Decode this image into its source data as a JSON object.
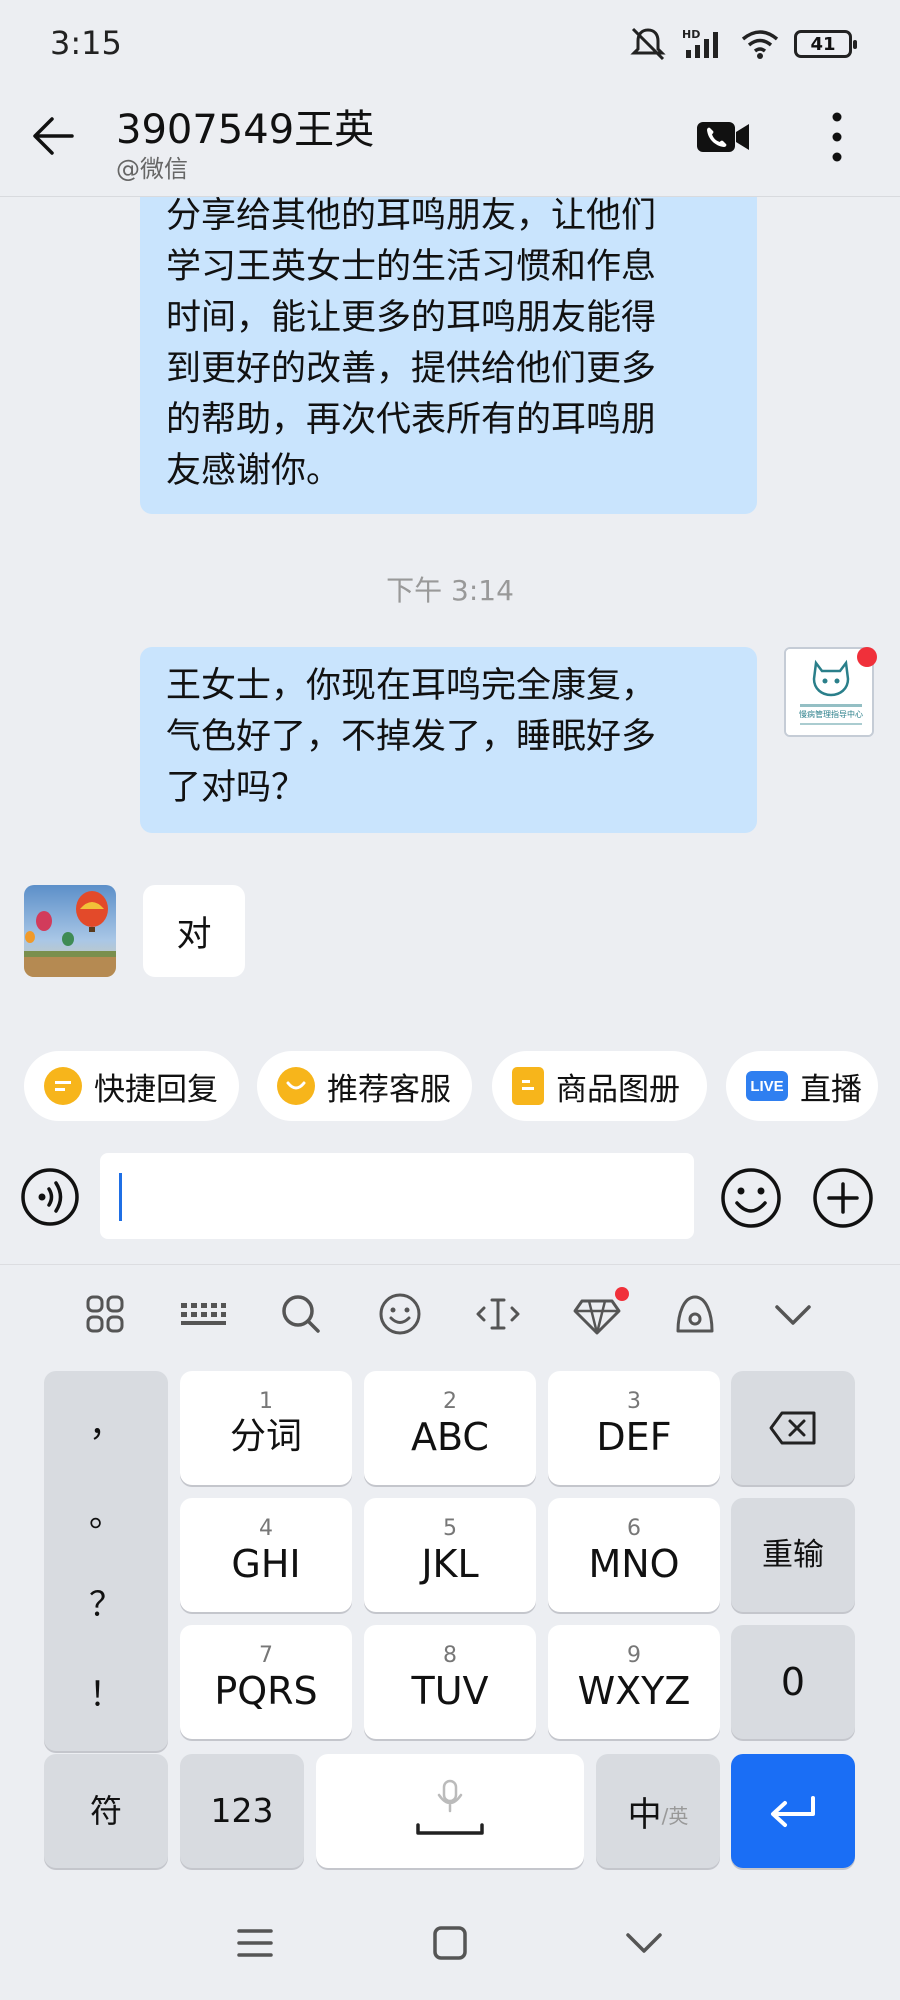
{
  "status": {
    "time": "3:15",
    "battery": "41",
    "network": "HD"
  },
  "header": {
    "title": "3907549王英",
    "subtitle": "@微信"
  },
  "messages": {
    "msg1": [
      "分享给其他的耳鸣朋友，让他们",
      "学习王英女士的生活习惯和作息",
      "时间，能让更多的耳鸣朋友能得",
      "到更好的改善，提供给他们更多",
      "的帮助，再次代表所有的耳鸣朋",
      "友感谢你。"
    ],
    "timestamp": "下午 3:14",
    "msg2": [
      "王女士，你现在耳鸣完全康复，",
      "气色好了，不掉发了，睡眠好多",
      "了对吗？"
    ],
    "msg3": "对"
  },
  "avatar_logo": {
    "line1": "慢病管理指导中心"
  },
  "quick_actions": [
    {
      "label": "快捷回复",
      "icon": "quick-reply-icon",
      "color": "#f7b51b"
    },
    {
      "label": "推荐客服",
      "icon": "service-icon",
      "color": "#f7b51b"
    },
    {
      "label": "商品图册",
      "icon": "catalog-icon",
      "color": "#f7b51b"
    },
    {
      "label": "直播",
      "icon": "live-icon",
      "icon_text": "LIVE",
      "color": "#2f7ff0"
    }
  ],
  "input": {
    "value": "",
    "placeholder": ""
  },
  "keyboard": {
    "punct": [
      "，",
      "。",
      "？",
      "！"
    ],
    "keys": [
      {
        "num": "1",
        "label": "分词"
      },
      {
        "num": "2",
        "label": "ABC"
      },
      {
        "num": "3",
        "label": "DEF"
      },
      {
        "num": "4",
        "label": "GHI"
      },
      {
        "num": "5",
        "label": "JKL"
      },
      {
        "num": "6",
        "label": "MNO"
      },
      {
        "num": "7",
        "label": "PQRS"
      },
      {
        "num": "8",
        "label": "TUV"
      },
      {
        "num": "9",
        "label": "WXYZ"
      }
    ],
    "reenter": "重输",
    "zero": "0",
    "symbol": "符",
    "num_mode": "123",
    "lang_main": "中",
    "lang_sub": "/英"
  },
  "colors": {
    "bubble_right": "#c9e4fd",
    "enter": "#1a6ef5",
    "badge": "#f0303a"
  }
}
